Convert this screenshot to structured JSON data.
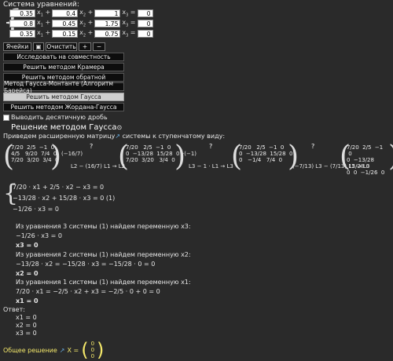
{
  "header": {
    "title": "Система уравнений:"
  },
  "system": {
    "rows": [
      {
        "coefs": [
          "0.35",
          "0.4",
          "1"
        ],
        "rhs": "0"
      },
      {
        "coefs": [
          "0.8",
          "0.45",
          "1.75"
        ],
        "rhs": "0"
      },
      {
        "coefs": [
          "0.35",
          "0.15",
          "0.75"
        ],
        "rhs": "0"
      }
    ],
    "ops": [
      "+",
      "+",
      "="
    ],
    "vars": [
      "x",
      "x",
      "x"
    ],
    "subs": [
      "1",
      "2",
      "3"
    ]
  },
  "toolbar": {
    "cells": "Ячейки",
    "icon": "▣",
    "clear": "Очистить",
    "plus": "+",
    "minus": "−"
  },
  "buttons": [
    "Исследовать на совместность",
    "Решить методом Крамера",
    "Решить методом обратной",
    "Метод Гаусса-Монтанте (Алгоритм Барейса)",
    "Решить методом Гаусса",
    "Решить методом Жордана-Гаусса"
  ],
  "checkbox": {
    "label": "Выводить десятичную дробь"
  },
  "solution": {
    "title": "Решение методом Гаусса",
    "intro": "Приведем расширенную матрицу",
    "intro2": "системы к ступенчатому виду:",
    "ops": [
      "L2 − (16/7) L1 → L2",
      "L3 − 1 · L1 → L3",
      "L3 − (7/15) L3 − (7/15) L2 → L3"
    ],
    "system1": [
      "7/20 · x1 + 2/5 · x2 − x3 = 0",
      "−13/28 · x2 + 15/28 · x3 = 0   (1)",
      "−1/26 · x3 = 0"
    ],
    "step3": "Из уравнения 3 системы (1) найдем переменную x3:",
    "step3a": "−1/26 · x3 = 0",
    "step3b": "x3 = 0",
    "step2": "Из уравнения 2 системы (1) найдем переменную x2:",
    "step2a": "−13/28 · x2 = −15/28 · x3 = −15/28 · 0 = 0",
    "step2b": "x2 = 0",
    "step1": "Из уравнения 1 системы (1) найдем переменную x1:",
    "step1a": "7/20 · x1 = −2/5 · x2 + x3 = −2/5 · 0 + 0 = 0",
    "step1b": "x1 = 0",
    "answer_label": "Ответ:",
    "answers": [
      "x1 = 0",
      "x2 = 0",
      "x3 = 0"
    ],
    "general_label": "Общее решение",
    "general_x": "X =",
    "general_vec": [
      "0",
      "0",
      "0"
    ]
  }
}
